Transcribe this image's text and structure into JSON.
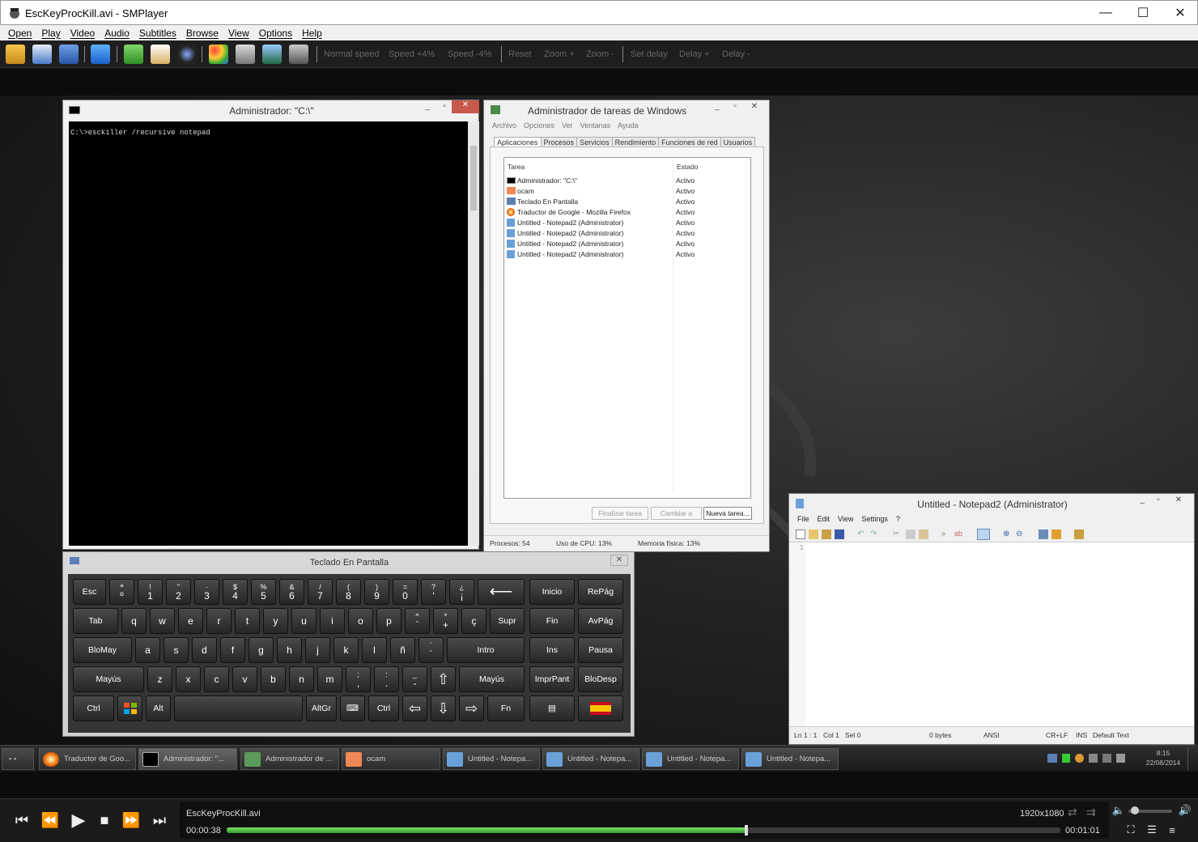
{
  "window": {
    "title": "EscKeyProcKill.avi - SMPlayer",
    "minimize": "—",
    "maximize": "☐",
    "close": "✕"
  },
  "menu": [
    "Open",
    "Play",
    "Video",
    "Audio",
    "Subtitles",
    "Browse",
    "View",
    "Options",
    "Help"
  ],
  "toolbar": {
    "normal_speed": "Normal speed",
    "speed_up": "Speed +4%",
    "speed_down": "Speed -4%",
    "reset": "Reset",
    "zoom_in": "Zoom +",
    "zoom_out": "Zoom -",
    "set_delay": "Set delay",
    "delay_plus": "Delay +",
    "delay_minus": "Delay -"
  },
  "cmd": {
    "title": "Administrador:  \"C:\\\"",
    "line": "C:\\>esckiller /recursive notepad"
  },
  "taskmgr": {
    "title": "Administrador de tareas de Windows",
    "menu": [
      "Archivo",
      "Opciones",
      "Ver",
      "Ventanas",
      "Ayuda"
    ],
    "tabs": [
      "Aplicaciones",
      "Procesos",
      "Servicios",
      "Rendimiento",
      "Funciones de red",
      "Usuarios"
    ],
    "col_task": "Tarea",
    "col_status": "Estado",
    "rows": [
      {
        "task": "Administrador:  \"C:\\\"",
        "status": "Activo"
      },
      {
        "task": "ocam",
        "status": "Activo"
      },
      {
        "task": "Teclado En Pantalla",
        "status": "Activo"
      },
      {
        "task": "Traductor de Google - Mozilla Firefox",
        "status": "Activo"
      },
      {
        "task": "Untitled - Notepad2 (Administrator)",
        "status": "Activo"
      },
      {
        "task": "Untitled - Notepad2 (Administrator)",
        "status": "Activo"
      },
      {
        "task": "Untitled - Notepad2 (Administrator)",
        "status": "Activo"
      },
      {
        "task": "Untitled - Notepad2 (Administrator)",
        "status": "Activo"
      }
    ],
    "btn_end": "Finalizar tarea",
    "btn_switch": "Cambiar a",
    "btn_new": "Nueva tarea...",
    "status_procs": "Procesos: 54",
    "status_cpu": "Uso de CPU: 13%",
    "status_mem": "Memoria física: 13%"
  },
  "osk": {
    "title": "Teclado En Pantalla"
  },
  "notepad": {
    "title": "Untitled - Notepad2 (Administrator)",
    "menu": [
      "File",
      "Edit",
      "View",
      "Settings",
      "?"
    ],
    "line_no": "1",
    "status": {
      "pos": "Ln 1 : 1",
      "col": "Col 1",
      "sel": "Sel 0",
      "size": "0 bytes",
      "enc": "ANSI",
      "eol": "CR+LF",
      "ins": "INS",
      "scheme": "Default Text"
    }
  },
  "taskbar": {
    "items": [
      "Traductor de Goo...",
      "Administrador: \"...",
      "Administrador de ...",
      "ocam",
      "Untitled - Notepa...",
      "Untitled - Notepa...",
      "Untitled - Notepa...",
      "Untitled - Notepa..."
    ],
    "time": "8:15",
    "date": "22/08/2014"
  },
  "player": {
    "filename": "EscKeyProcKill.avi",
    "resolution": "1920x1080",
    "elapsed": "00:00:38",
    "total": "00:01:01",
    "progress": 0.623,
    "volume": 0.05
  }
}
